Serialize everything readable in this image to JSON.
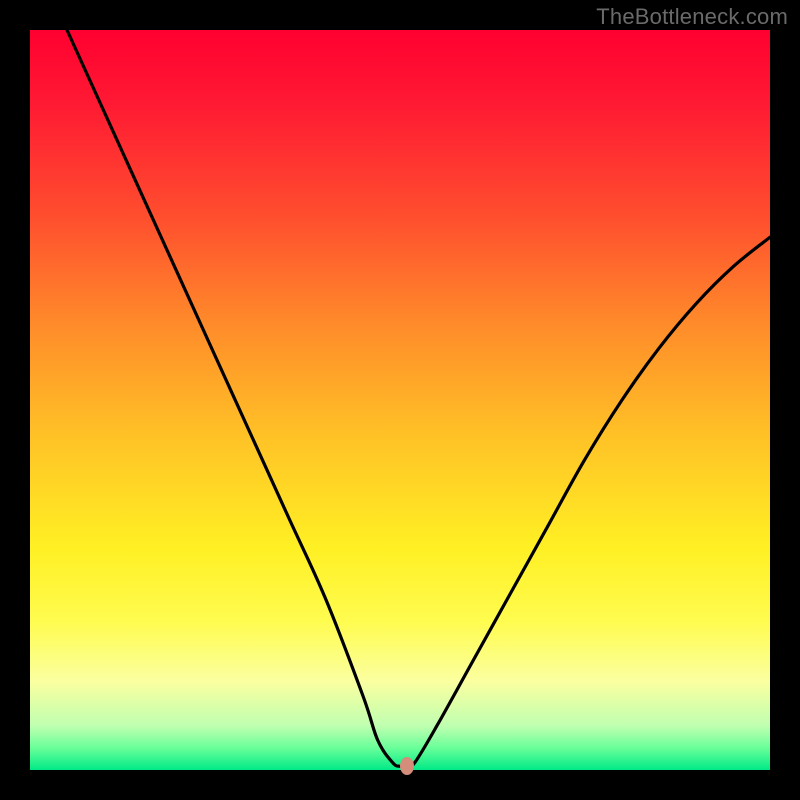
{
  "watermark": "TheBottleneck.com",
  "colors": {
    "frame": "#000000",
    "curve": "#000000",
    "marker": "#d38d7a",
    "gradient_top": "#ff0030",
    "gradient_bottom": "#00ea86"
  },
  "chart_data": {
    "type": "line",
    "title": "",
    "xlabel": "",
    "ylabel": "",
    "xlim": [
      0,
      100
    ],
    "ylim": [
      0,
      100
    ],
    "grid": false,
    "legend": false,
    "series": [
      {
        "name": "bottleneck-curve",
        "x": [
          5,
          10,
          15,
          20,
          25,
          30,
          35,
          40,
          45,
          47,
          49,
          50,
          51,
          52,
          55,
          60,
          65,
          70,
          75,
          80,
          85,
          90,
          95,
          100
        ],
        "y": [
          100,
          89,
          78,
          67,
          56,
          45,
          34,
          23,
          10,
          4,
          1,
          0.5,
          0.5,
          1,
          6,
          15,
          24,
          33,
          42,
          50,
          57,
          63,
          68,
          72
        ]
      }
    ],
    "marker": {
      "x": 51,
      "y": 0.5
    },
    "notes": "V-shaped bottleneck curve over vertical red-to-green gradient. Minimum near x≈51. Values estimated from pixel positions; axes are unlabeled."
  }
}
